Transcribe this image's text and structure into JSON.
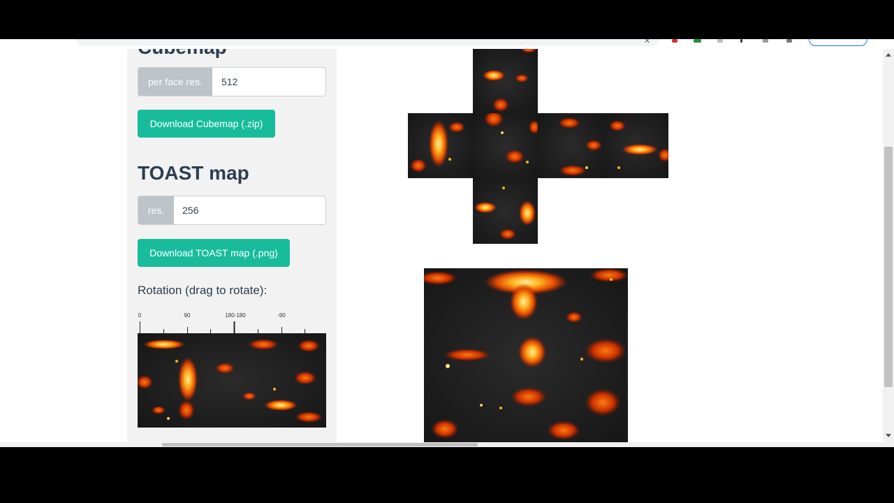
{
  "cubemap": {
    "heading": "Cubemap",
    "per_face_label": "per face res.",
    "per_face_value": "512",
    "download_label": "Download Cubemap (.zip)"
  },
  "toast": {
    "heading": "TOAST map",
    "res_label": "res.",
    "res_value": "256",
    "download_label": "Download TOAST map (.png)"
  },
  "rotation": {
    "label": "Rotation (drag to rotate):",
    "ticks": [
      "0",
      "90",
      "180-180",
      "-90"
    ]
  },
  "icons": [
    "close-icon",
    "extension-icon",
    "profile-icon"
  ],
  "colors": {
    "accent": "#18bc9c",
    "heading": "#2c3e50",
    "addon": "#bec3c8",
    "sidebar": "#f2f2f2",
    "lava_hot": "#ffe680",
    "lava": "#e05a00",
    "rock": "#1a1a1a"
  }
}
